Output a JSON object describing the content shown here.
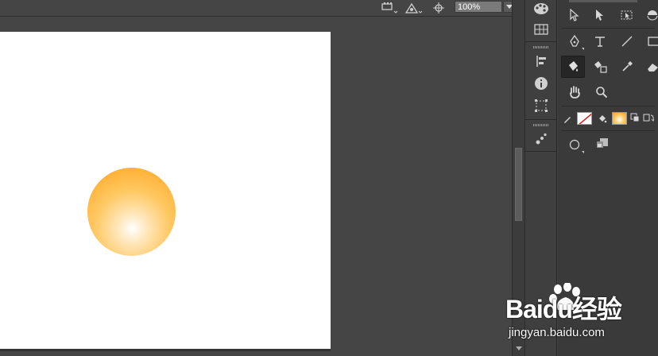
{
  "control_bar": {
    "zoom_value": "100%",
    "icons": [
      "arrange-icon",
      "transform-icon",
      "reference-point-icon"
    ]
  },
  "document": {
    "artboard_color": "#ffffff",
    "shape": {
      "type": "ellipse",
      "fill": "radial-gradient",
      "gradient_stops": [
        "#ffffff",
        "#ffc862",
        "#ffa31a"
      ]
    }
  },
  "dock": {
    "buttons": [
      "color-icon",
      "swatches-icon",
      "align-icon",
      "info-icon",
      "transform-panel-icon",
      "symbols-icon"
    ]
  },
  "tools_panel": {
    "tools": [
      "selection-tool",
      "direct-selection-tool",
      "artboard-tool",
      "shape-builder-tool",
      "pen-tool",
      "type-tool",
      "line-tool",
      "rectangle-tool",
      "paint-bucket-tool",
      "live-paint-selection-tool",
      "eyedropper-tool",
      "eraser-tool",
      "hand-tool",
      "zoom-tool"
    ],
    "fill_stroke": {
      "stroke": "none",
      "fill": "gradient"
    },
    "draw_mode": "draw-normal"
  },
  "watermark": {
    "brand": "Baidu经验",
    "url": "jingyan.baidu.com"
  },
  "colors": {
    "ui_background": "#454545",
    "panel": "#3a3a3a",
    "gradient_inner": "#ffffff",
    "gradient_outer": "#ffa31a"
  }
}
